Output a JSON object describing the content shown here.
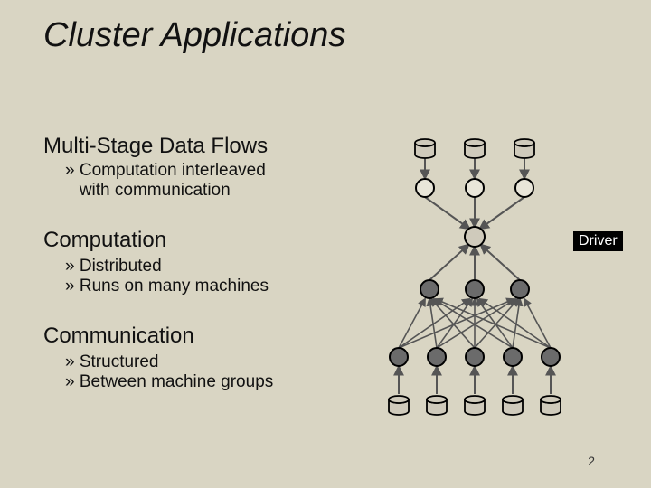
{
  "title": "Cluster Applications",
  "sections": {
    "s0": {
      "heading": "Multi-Stage Data Flows",
      "bullets": {
        "b0": "» Computation interleaved\n   with communication"
      }
    },
    "s1": {
      "heading": "Computation",
      "bullets": {
        "b0": "» Distributed",
        "b1": "» Runs on many machines"
      }
    },
    "s2": {
      "heading": "Communication",
      "bullets": {
        "b0": "» Structured",
        "b1": "» Between machine groups"
      }
    }
  },
  "driver_label": "Driver",
  "page_number": "2",
  "diagram": {
    "description": "Multi-stage data flow: 3 source DBs -> 3 light nodes -> 1 driver node -> 3 dark nodes -> 5 dark nodes -> 5 sink DBs",
    "layers": [
      {
        "name": "sources",
        "count": 3,
        "type": "db"
      },
      {
        "name": "stage1",
        "count": 3,
        "type": "node-light"
      },
      {
        "name": "driver",
        "count": 1,
        "type": "node-light"
      },
      {
        "name": "stage2",
        "count": 3,
        "type": "node-dark"
      },
      {
        "name": "stage3",
        "count": 5,
        "type": "node-dark"
      },
      {
        "name": "sinks",
        "count": 5,
        "type": "db"
      }
    ]
  }
}
